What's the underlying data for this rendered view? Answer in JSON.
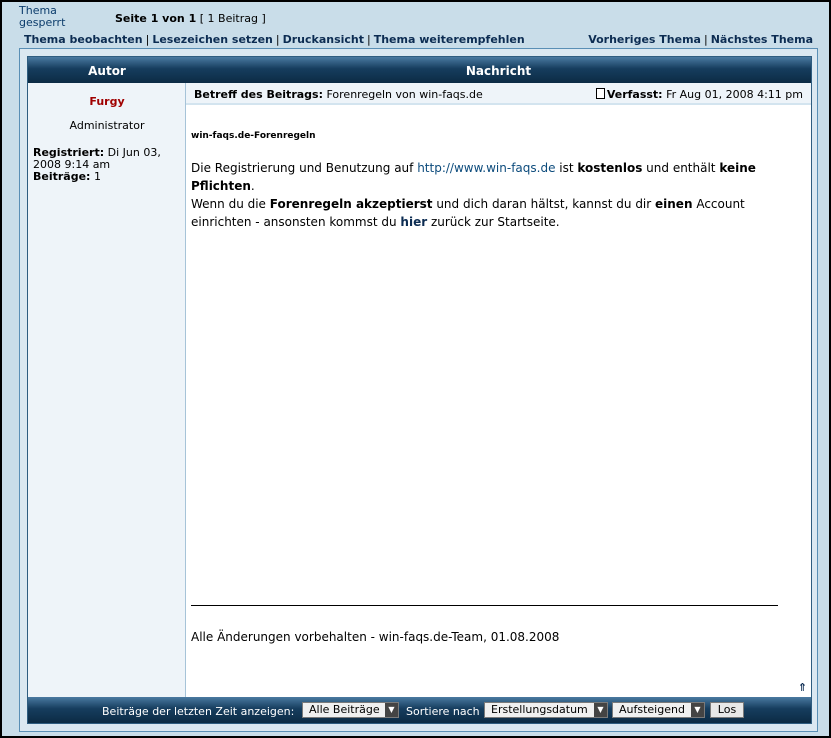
{
  "header": {
    "locked_label": "Thema gesperrt",
    "page_label": "Seite 1 von 1",
    "post_count": "[ 1 Beitrag ]",
    "nav_left": [
      "Thema beobachten",
      "Lesezeichen setzen",
      "Druckansicht",
      "Thema weiterempfehlen"
    ],
    "nav_right": [
      "Vorheriges Thema",
      "Nächstes Thema"
    ]
  },
  "table": {
    "col_author": "Autor",
    "col_message": "Nachricht"
  },
  "author": {
    "name": "Furgy",
    "rank": "Administrator",
    "registered_label": "Registriert:",
    "registered_value": "Di Jun 03, 2008 9:14 am",
    "posts_label": "Beiträge:",
    "posts_value": "1"
  },
  "post": {
    "subject_label": "Betreff des Beitrags:",
    "subject_value": "Forenregeln von win-faqs.de",
    "posted_label": "Verfasst:",
    "posted_value": "Fr Aug 01, 2008 4:11 pm",
    "heading": "win-faqs.de-Forenregeln",
    "t1": "Die Registrierung und Benutzung auf ",
    "url": "http://www.win-faqs.de",
    "t2": " ist ",
    "b1": "kostenlos",
    "t3": " und enthält ",
    "b2": "keine Pflichten",
    "t4": ".",
    "t5": "Wenn du die ",
    "b3": "Forenregeln akzeptierst",
    "t6": " und dich daran hältst, kannst du dir ",
    "b4": "einen",
    "t7": " Account einrichten - ansonsten kommst du ",
    "b5": "hier",
    "t8": " zurück zur Startseite.",
    "footer": "Alle Änderungen vorbehalten - win-faqs.de-Team, 01.08.2008"
  },
  "bottom": {
    "show_label": "Beiträge der letzten Zeit anzeigen:",
    "show_value": "Alle Beiträge",
    "sort_label": "Sortiere nach",
    "sort_value": "Erstellungsdatum",
    "order_value": "Aufsteigend",
    "go_label": "Los"
  }
}
